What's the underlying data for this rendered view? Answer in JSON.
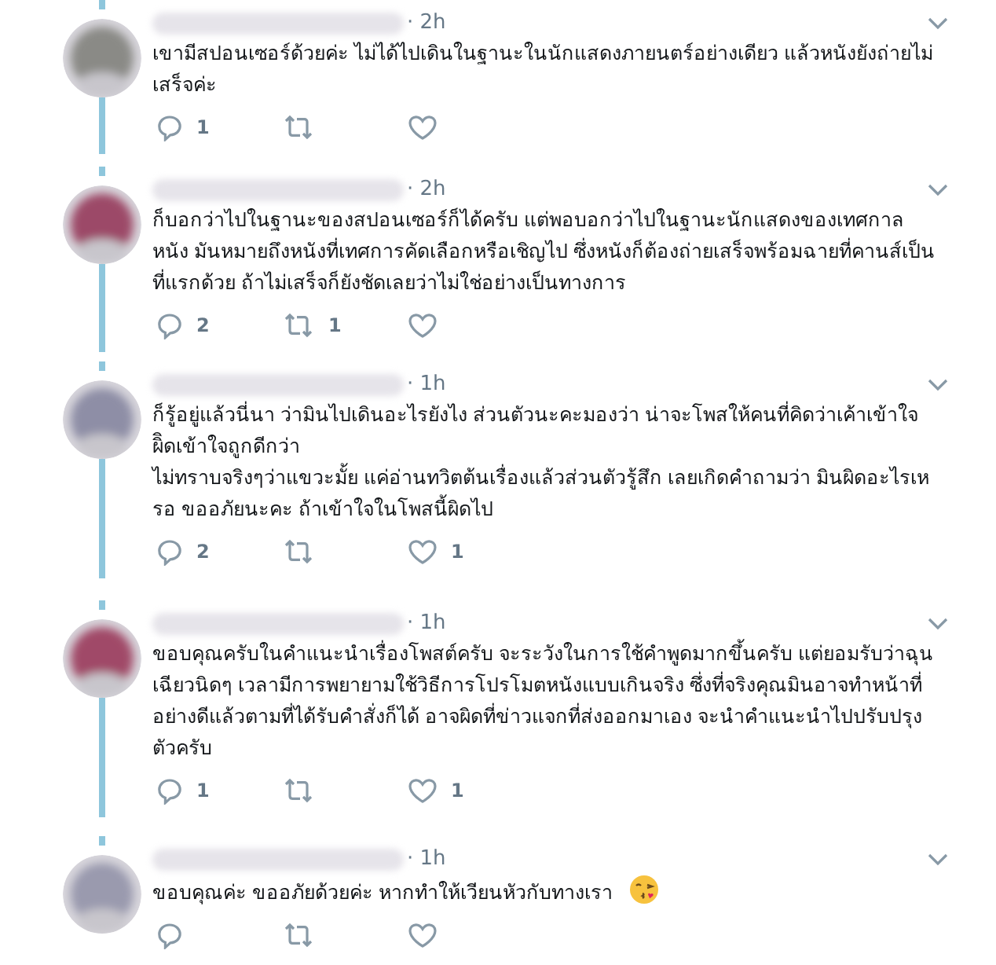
{
  "tweets": [
    {
      "time": "· 2h",
      "paragraphs": [
        "เขามีสปอนเซอร์ด้วยค่ะ ไม่ได้ไปเดินในฐานะในนักแสดงภายนตร์อย่างเดียว แล้วหนังยังถ่ายไม่เสร็จค่ะ"
      ],
      "replies": "1",
      "emoji": false
    },
    {
      "time": "· 2h",
      "paragraphs": [
        "ก็บอกว่าไปในฐานะของสปอนเซอร์ก็ได้ครับ แต่พอบอกว่าไปในฐานะนักแสดงของเทศกาลหนัง มันหมายถึงหนังที่เทศการคัดเลือกหรือเชิญไป ซึ่งหนังก็ต้องถ่ายเสร็จพร้อมฉายที่คานส์เป็นที่แรกด้วย ถ้าไม่เสร็จก็ยังชัดเลยว่าไม่ใช่อย่างเป็นทางการ"
      ],
      "replies": "2",
      "retweets": "1",
      "emoji": false
    },
    {
      "time": "· 1h",
      "paragraphs": [
        "ก็รู้อยู่แล้วนี่นา ว่ามินไปเดินอะไรยังไง ส่วนตัวนะคะมองว่า น่าจะโพสให้คนที่คิดว่าเค้าเข้าใจผิิดเข้าใจถูกดีกว่า",
        "ไม่ทราบจริงๆว่าแขวะมั้ย แค่อ่านทวิตต้นเรื่องแล้วส่วนตัวรู้สึก เลยเกิดคำถามว่า มินผิดอะไรเหรอ ขออภัยนะคะ ถ้าเข้าใจในโพสนี้ผิดไป"
      ],
      "replies": "2",
      "likes": "1",
      "emoji": false
    },
    {
      "time": "· 1h",
      "paragraphs": [
        "ขอบคุณครับในคำแนะนำเรื่องโพสต์ครับ จะระวังในการใช้คำพูดมากขึ้นครับ แต่ยอมรับว่าฉุนเฉียวนิดๆ เวลามีการพยายามใช้วิธีการโปรโมตหนังแบบเกินจริง ซึ่งที่จริงคุณมินอาจทำหน้าที่อย่างดีแล้วตามที่ได้รับคำสั่งก็ได้ อาจผิดที่ข่าวแจกที่ส่งออกมาเอง จะนำคำแนะนำไปปรับปรุงตัวครับ"
      ],
      "replies": "1",
      "likes": "1",
      "emoji": false
    },
    {
      "time": "· 1h",
      "paragraphs": [
        "ขอบคุณค่ะ ขออภัยด้วยค่ะ หากทำให้เวียนหัวกับทางเรา"
      ],
      "emoji": true
    }
  ]
}
